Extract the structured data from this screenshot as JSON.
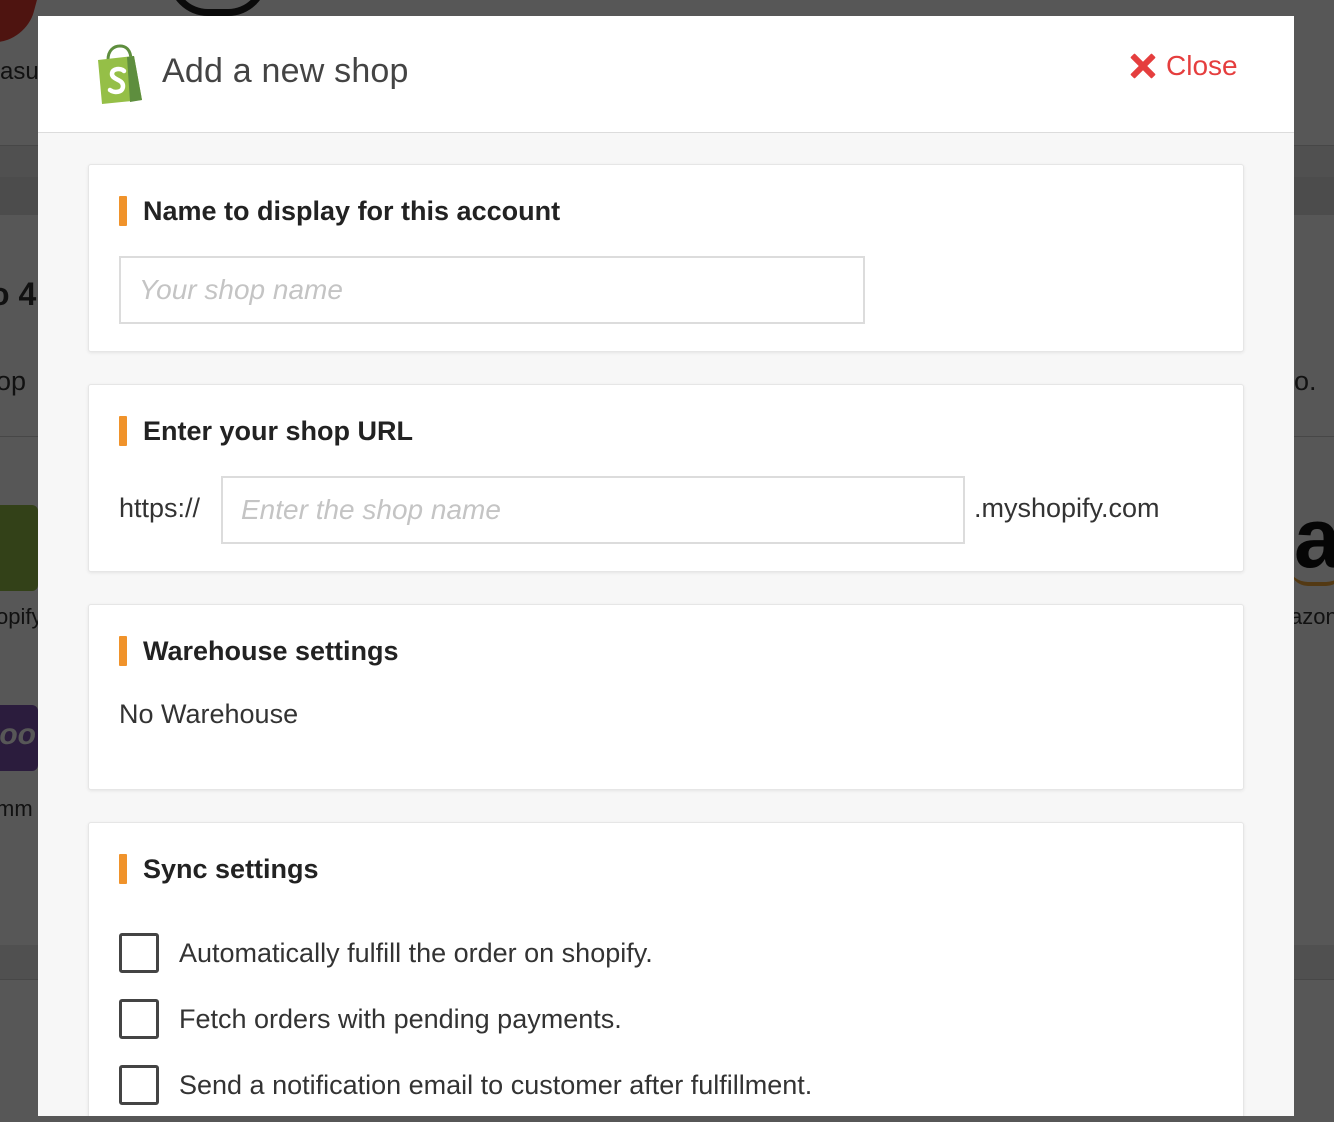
{
  "background": {
    "fragments": [
      "asu",
      "o 4",
      "op",
      "o.",
      "opify",
      "azon",
      "mm"
    ],
    "logos": [
      "shopify-logo",
      "woocommerce-logo",
      "amazon-logo",
      "red-brand-logo",
      "ring-brand-logo"
    ]
  },
  "modal": {
    "title": "Add a new shop",
    "close_label": "Close",
    "icons": {
      "close": "close-x-icon",
      "logo": "shopify-bag-icon"
    }
  },
  "sections": {
    "name": {
      "title": "Name to display for this account",
      "input_value": "",
      "input_placeholder": "Your shop name"
    },
    "url": {
      "title": "Enter your shop URL",
      "prefix": "https://",
      "input_value": "",
      "input_placeholder": "Enter the shop name",
      "suffix": ".myshopify.com"
    },
    "warehouse": {
      "title": "Warehouse settings",
      "value": "No Warehouse"
    },
    "sync": {
      "title": "Sync settings",
      "options": [
        {
          "label": "Automatically fulfill the order on shopify.",
          "checked": false
        },
        {
          "label": "Fetch orders with pending payments.",
          "checked": false
        },
        {
          "label": "Send a notification email to customer after fulfillment.",
          "checked": false
        }
      ]
    }
  },
  "colors": {
    "accent": "#f0932b",
    "close": "#e53e3e",
    "shopify_green": "#95bf47"
  }
}
